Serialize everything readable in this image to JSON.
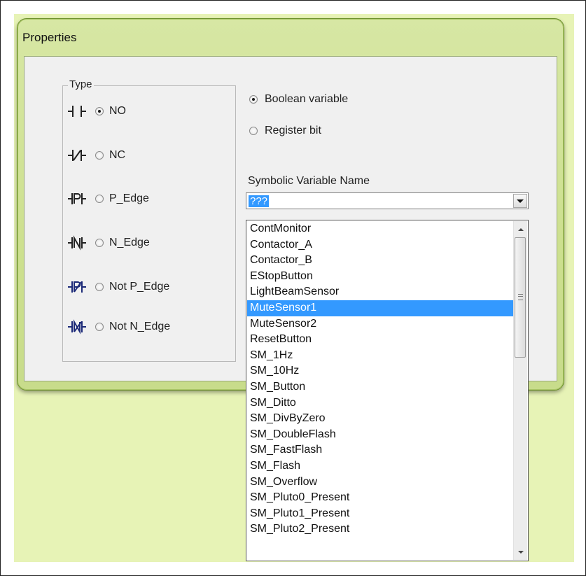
{
  "window": {
    "title": "Properties"
  },
  "type_group": {
    "label": "Type",
    "options": [
      {
        "label": "NO",
        "selected": true,
        "icon": "contact-no-icon"
      },
      {
        "label": "NC",
        "selected": false,
        "icon": "contact-nc-icon"
      },
      {
        "label": "P_Edge",
        "selected": false,
        "icon": "contact-p-edge-icon"
      },
      {
        "label": "N_Edge",
        "selected": false,
        "icon": "contact-n-edge-icon"
      },
      {
        "label": "Not P_Edge",
        "selected": false,
        "icon": "contact-not-p-edge-icon"
      },
      {
        "label": "Not N_Edge",
        "selected": false,
        "icon": "contact-not-n-edge-icon"
      }
    ]
  },
  "source": {
    "options": [
      {
        "label": "Boolean variable",
        "selected": true
      },
      {
        "label": "Register bit",
        "selected": false
      }
    ]
  },
  "symbolic_variable": {
    "label": "Symbolic Variable Name",
    "value": "???",
    "dropdown_items": [
      "ContMonitor",
      "Contactor_A",
      "Contactor_B",
      "EStopButton",
      "LightBeamSensor",
      "MuteSensor1",
      "MuteSensor2",
      "ResetButton",
      "SM_1Hz",
      "SM_10Hz",
      "SM_Button",
      "SM_Ditto",
      "SM_DivByZero",
      "SM_DoubleFlash",
      "SM_FastFlash",
      "SM_Flash",
      "SM_Overflow",
      "SM_Pluto0_Present",
      "SM_Pluto1_Present",
      "SM_Pluto2_Present"
    ],
    "highlighted_item": "MuteSensor1"
  },
  "colors": {
    "selection": "#3399ff",
    "window_frame": "#cde08f",
    "background": "#e7f3b6"
  }
}
